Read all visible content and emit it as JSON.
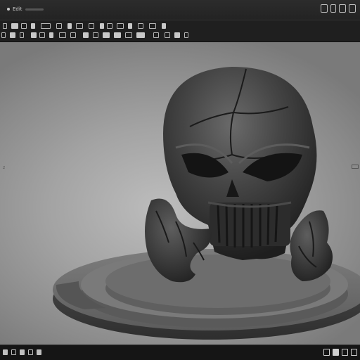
{
  "window": {
    "title": "Edit"
  },
  "colors": {
    "chrome_dark": "#1f1f1f",
    "viewport_bg": "#a3a3a3",
    "model_dark": "#3a3a3a",
    "pedestal": "#6e6e6e"
  },
  "viewport": {
    "model_name": "skull-sculpture",
    "marker": "2"
  },
  "icons": {
    "title_actions": [
      "window-icon",
      "tile-icon",
      "panel-icon",
      "close-icon"
    ],
    "status_left": [
      "play-icon",
      "grid-icon",
      "frame-icon",
      "camera-icon",
      "light-icon"
    ],
    "status_right": [
      "layout-icon",
      "render-icon",
      "settings-icon",
      "view-icon"
    ]
  }
}
